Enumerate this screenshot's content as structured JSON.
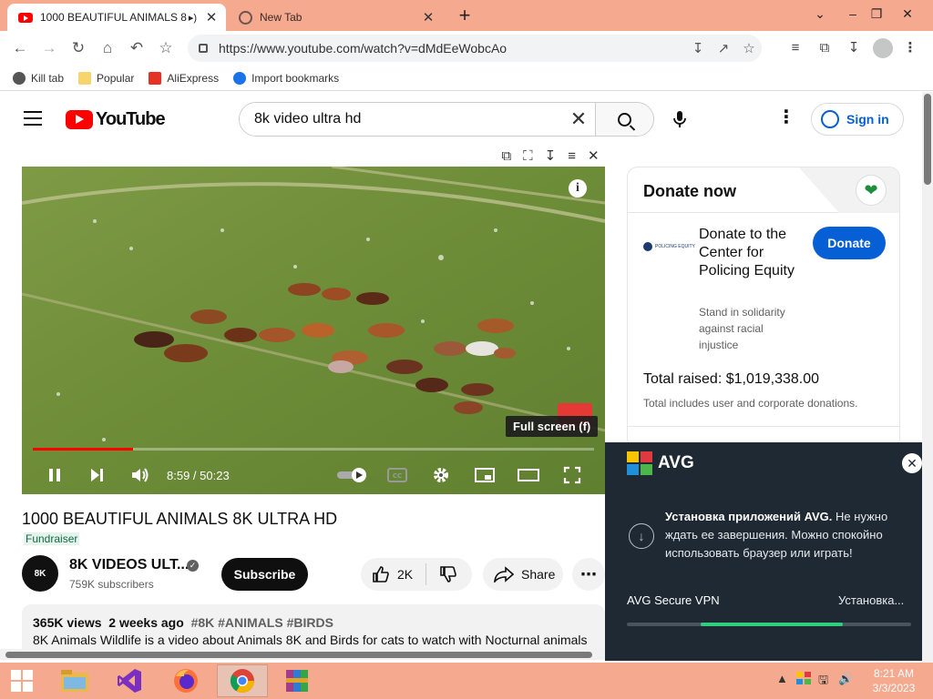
{
  "browser": {
    "tabs": [
      {
        "title": "1000 BEAUTIFUL ANIMALS 8",
        "active": true
      },
      {
        "title": "New Tab",
        "active": false
      }
    ],
    "url": "https://www.youtube.com/watch?v=dMdEeWobcAo",
    "bookmarks": [
      "Kill tab",
      "Popular",
      "AliExpress",
      "Import bookmarks"
    ]
  },
  "youtube": {
    "logo_text": "YouTube",
    "search_value": "8k video ultra hd",
    "signin_label": "Sign in"
  },
  "player": {
    "timecode": "8:59 / 50:23",
    "progress": 0.179,
    "tooltip": "Full screen (f)",
    "info_glyph": "i"
  },
  "video": {
    "title": "1000 BEAUTIFUL ANIMALS 8K ULTRA HD",
    "badge": "Fundraiser",
    "channel": "8K VIDEOS ULT...",
    "subscribers": "759K subscribers",
    "avatar_text": "8K",
    "subscribe_label": "Subscribe",
    "likes": "2K",
    "share_label": "Share",
    "views": "365K views",
    "age": "2 weeks ago",
    "tags": "#8K #ANIMALS #BIRDS",
    "description": "8K Animals Wildlife is a video about Animals 8K and Birds for cats to watch with Nocturnal animals"
  },
  "donate": {
    "heading": "Donate now",
    "org_name": "Donate to the Center for Policing Equity",
    "org_sub": "Stand in solidarity against racial injustice",
    "button": "Donate",
    "raised": "Total raised: $1,019,338.00",
    "raised_note": "Total includes user and corporate donations.",
    "org_logo_text": "POLICING EQUITY"
  },
  "avg": {
    "brand": "AVG",
    "message_bold": "Установка приложений AVG.",
    "message_rest": " Не нужно ждать ее завершения. Можно спокойно использовать браузер или играть!",
    "product": "AVG Secure VPN",
    "status": "Установка...",
    "progress_start": 0.26,
    "progress_fill": 0.5
  },
  "taskbar": {
    "time": "8:21 AM",
    "date": "3/3/2023"
  },
  "colors": {
    "chrome_frame": "#f5a98e",
    "youtube_red": "#ff0000",
    "link_blue": "#065fd4",
    "avg_bg": "#1f2933",
    "avg_green": "#2fcf7c"
  }
}
